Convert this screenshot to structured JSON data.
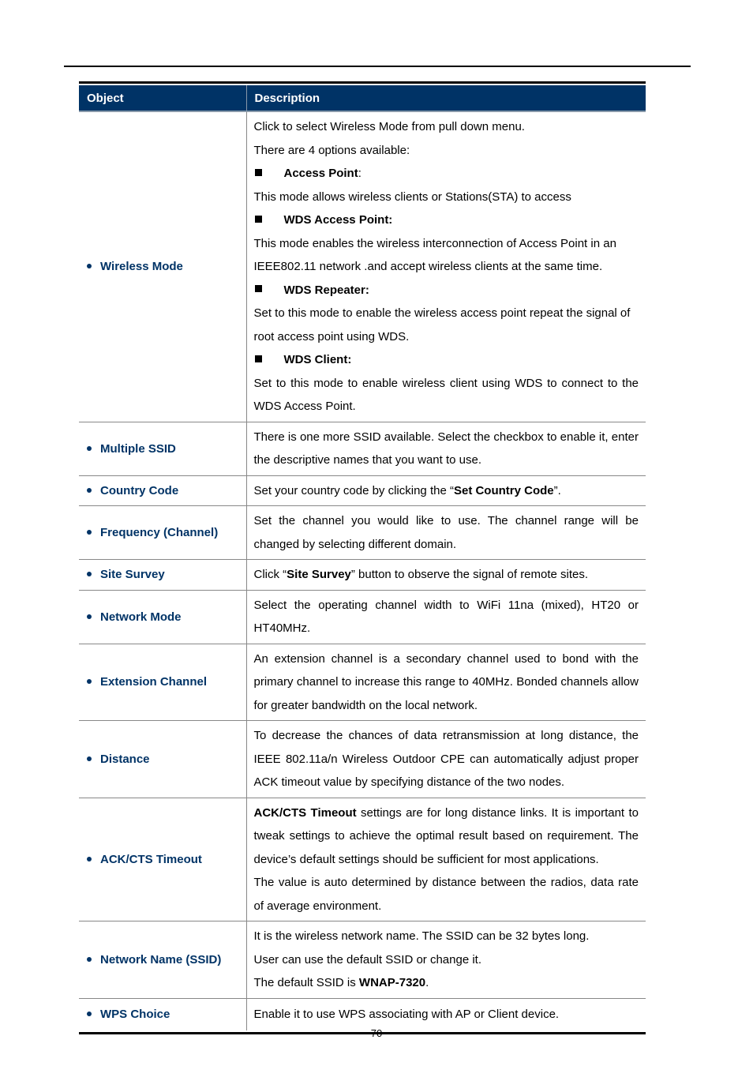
{
  "table": {
    "header": {
      "object": "Object",
      "description": "Description"
    },
    "rows": [
      {
        "object": "Wireless Mode",
        "lines": [
          {
            "type": "text",
            "text": "Click to select Wireless Mode from pull down menu."
          },
          {
            "type": "text",
            "text": "There are 4 options available:"
          },
          {
            "type": "option",
            "bold": "Access Point",
            "rest": ":"
          },
          {
            "type": "text",
            "text": "This mode allows wireless clients or Stations(STA) to access"
          },
          {
            "type": "option",
            "bold": "WDS Access Point:",
            "rest": ""
          },
          {
            "type": "text",
            "text": "This mode enables the wireless interconnection of Access Point in an IEEE802.11 network .and accept wireless clients at the same time."
          },
          {
            "type": "option",
            "bold": "WDS Repeater:",
            "rest": ""
          },
          {
            "type": "text",
            "text": "Set to this mode to enable the wireless access point repeat the signal of root access point using WDS."
          },
          {
            "type": "option",
            "bold": "WDS Client:",
            "rest": ""
          },
          {
            "type": "text",
            "text": "Set to this mode to enable wireless client using WDS to connect to the WDS Access Point."
          }
        ]
      },
      {
        "object": "Multiple SSID",
        "text": "There is one more SSID available. Select the checkbox to enable it, enter the descriptive names that you want to use."
      },
      {
        "object": "Country Code",
        "pre": "Set your country code by clicking the “",
        "bold": "Set Country Code",
        "post": "”."
      },
      {
        "object": "Frequency (Channel)",
        "text": "Set the channel you would like to use. The channel range will be changed by selecting different domain."
      },
      {
        "object": "Site Survey",
        "pre": "Click “",
        "bold": "Site Survey",
        "post": "” button to observe the signal of remote sites."
      },
      {
        "object": "Network Mode",
        "text": "Select the operating channel width to WiFi 11na (mixed),  HT20 or HT40MHz."
      },
      {
        "object": "Extension Channel",
        "text": "An extension channel is a secondary channel used to bond with the primary channel to increase this range to 40MHz. Bonded channels allow for greater bandwidth on the local network."
      },
      {
        "object": "Distance",
        "text": "To decrease the chances of data retransmission at long distance, the IEEE 802.11a/n Wireless Outdoor CPE can automatically adjust proper ACK timeout value by specifying distance of the two nodes."
      },
      {
        "object": "ACK/CTS Timeout",
        "p1_bold": "ACK/CTS Timeout",
        "p1_rest": " settings are for long distance links. It is important to tweak settings to achieve the optimal result based on requirement. The device’s default settings should be sufficient for most applications.",
        "p2": "The value is auto determined by distance between the radios, data rate of average environment."
      },
      {
        "object": "Network Name (SSID)",
        "l1": "It is the wireless network name. The SSID can be 32 bytes long.",
        "l2": "User can use the default SSID or change it.",
        "l3_pre": "The default SSID is ",
        "l3_bold": "WNAP-7320",
        "l3_post": "."
      },
      {
        "object": "WPS Choice",
        "text": "Enable it to use WPS associating with AP or Client device."
      }
    ]
  },
  "footer": {
    "page_number": "-70-"
  },
  "colors": {
    "header_bg": "#003366",
    "object_text": "#003366"
  }
}
